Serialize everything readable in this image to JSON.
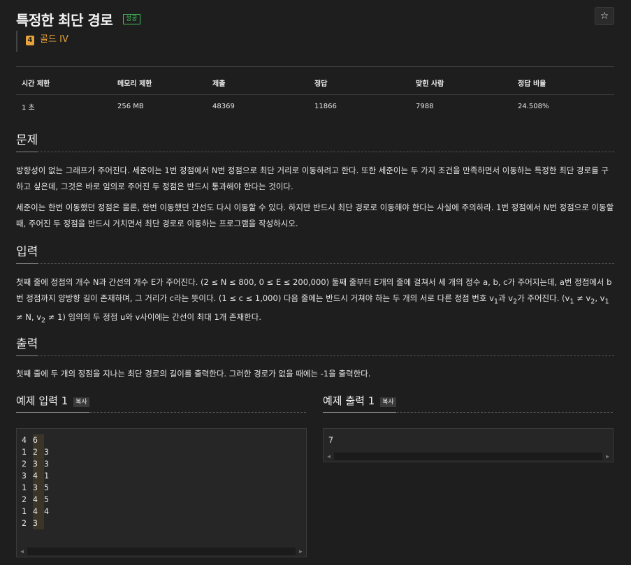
{
  "header": {
    "title": "특정한 최단 경로",
    "result_badge": "성공",
    "star_glyph": "☆"
  },
  "tier": {
    "level": "4",
    "label": "골드 IV",
    "color": "#e8a23a"
  },
  "stats": {
    "headers": [
      "시간 제한",
      "메모리 제한",
      "제출",
      "정답",
      "맞힌 사람",
      "정답 비율"
    ],
    "values": [
      "1 초",
      "256 MB",
      "48369",
      "11866",
      "7988",
      "24.508%"
    ]
  },
  "sections": {
    "problem": {
      "title": "문제",
      "p1": "방향성이 없는 그래프가 주어진다. 세준이는 1번 정점에서 N번 정점으로 최단 거리로 이동하려고 한다. 또한 세준이는 두 가지 조건을 만족하면서 이동하는 특정한 최단 경로를 구하고 싶은데, 그것은 바로 임의로 주어진 두 정점은 반드시 통과해야 한다는 것이다.",
      "p2": "세준이는 한번 이동했던 정점은 물론, 한번 이동했던 간선도 다시 이동할 수 있다. 하지만 반드시 최단 경로로 이동해야 한다는 사실에 주의하라. 1번 정점에서 N번 정점으로 이동할 때, 주어진 두 정점을 반드시 거치면서 최단 경로로 이동하는 프로그램을 작성하시오."
    },
    "input": {
      "title": "입력",
      "p_part1": "첫째 줄에 정점의 개수 N과 간선의 개수 E가 주어진다. (2 ≤ N ≤ 800, 0 ≤ E ≤ 200,000) 둘째 줄부터 E개의 줄에 걸쳐서 세 개의 정수 a, b, c가 주어지는데, a번 정점에서 b번 정점까지 양방향 길이 존재하며, 그 거리가 c라는 뜻이다. (1 ≤ c ≤ 1,000) 다음 줄에는 반드시 거쳐야 하는 두 개의 서로 다른 정점 번호 v",
      "p_part2": "과 v",
      "p_part3": "가 주어진다. (v",
      "p_part4": " ≠ v",
      "p_part5": ", v",
      "p_part6": " ≠ N, v",
      "p_part7": " ≠ 1) 임의의 두 정점 u와 v사이에는 간선이 최대 1개 존재한다.",
      "sub1": "1",
      "sub2": "2"
    },
    "output": {
      "title": "출력",
      "p": "첫째 줄에 두 개의 정점을 지나는 최단 경로의 길이를 출력한다. 그러한 경로가 없을 때에는 -1을 출력한다."
    }
  },
  "samples": {
    "input": {
      "title": "예제 입력 1",
      "copy_label": "복사",
      "lines": [
        [
          "4",
          "6"
        ],
        [
          "1",
          "2",
          "3"
        ],
        [
          "2",
          "3",
          "3"
        ],
        [
          "3",
          "4",
          "1"
        ],
        [
          "1",
          "3",
          "5"
        ],
        [
          "2",
          "4",
          "5"
        ],
        [
          "1",
          "4",
          "4"
        ],
        [
          "2",
          "3"
        ]
      ]
    },
    "output": {
      "title": "예제 출력 1",
      "copy_label": "복사",
      "lines": [
        [
          "7"
        ]
      ]
    }
  },
  "scroll": {
    "left": "◀",
    "right": "▶"
  }
}
